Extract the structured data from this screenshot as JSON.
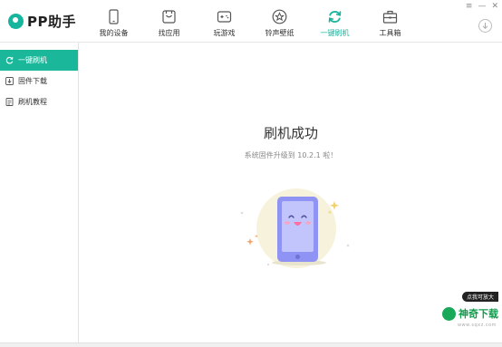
{
  "app": {
    "logo_text": "PP助手",
    "accent_color": "#18b59e"
  },
  "nav": {
    "tabs": [
      {
        "label": "我的设备",
        "icon": "phone-icon",
        "active": false
      },
      {
        "label": "找应用",
        "icon": "app-bag-icon",
        "active": false
      },
      {
        "label": "玩游戏",
        "icon": "gamepad-icon",
        "active": false
      },
      {
        "label": "铃声壁纸",
        "icon": "star-icon",
        "active": false
      },
      {
        "label": "一键刷机",
        "icon": "refresh-icon",
        "active": true
      },
      {
        "label": "工具箱",
        "icon": "toolbox-icon",
        "active": false
      }
    ]
  },
  "window_controls": {
    "menu": "≡",
    "minimize": "—",
    "close": "✕"
  },
  "sidebar": {
    "items": [
      {
        "label": "一键刷机",
        "icon": "refresh-icon",
        "active": true
      },
      {
        "label": "固件下载",
        "icon": "download-icon",
        "active": false
      },
      {
        "label": "刷机教程",
        "icon": "document-icon",
        "active": false
      }
    ]
  },
  "main": {
    "title": "刷机成功",
    "subtitle": "系统固件升级到 10.2.1 啦！"
  },
  "watermark": {
    "tag": "点我可放大",
    "text": "神奇下载",
    "sub": "www.sqxz.com"
  }
}
